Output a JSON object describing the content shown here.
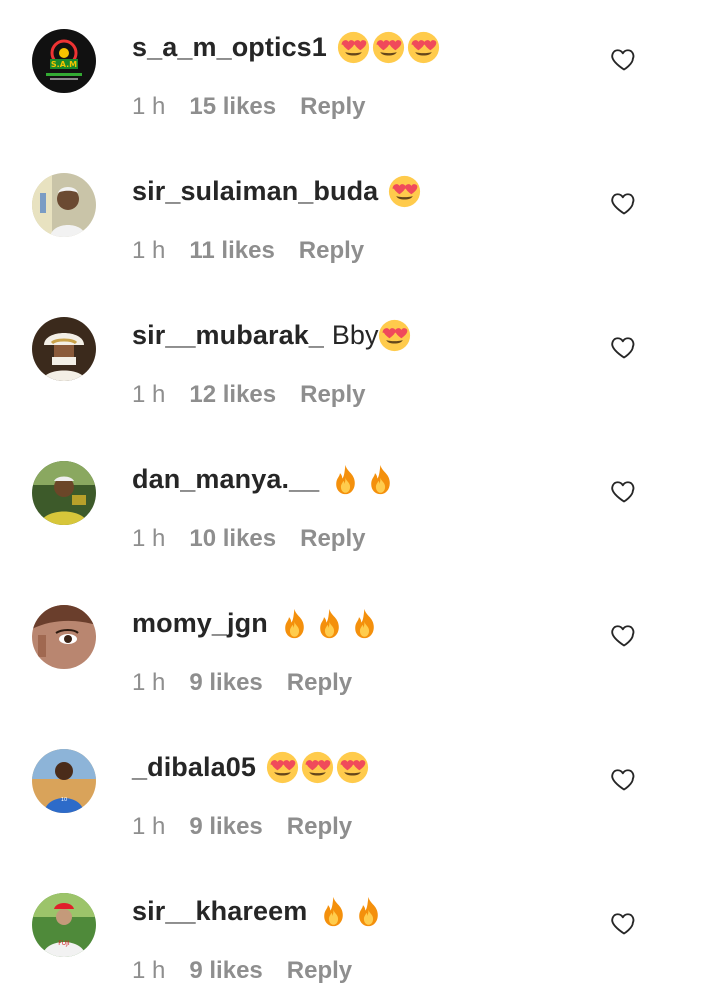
{
  "comments": [
    {
      "username": "s_a_m_optics1",
      "text": "",
      "emojis": [
        "heart-eyes",
        "heart-eyes",
        "heart-eyes"
      ],
      "time": "1 h",
      "likes": "15 likes",
      "reply": "Reply",
      "avatar_logo_text": "S.A.M"
    },
    {
      "username": "sir_sulaiman_buda",
      "text": "",
      "emojis": [
        "heart-eyes"
      ],
      "time": "1 h",
      "likes": "11 likes",
      "reply": "Reply"
    },
    {
      "username": "sir__mubarak_",
      "text": "Bby",
      "emojis": [
        "heart-eyes"
      ],
      "time": "1 h",
      "likes": "12 likes",
      "reply": "Reply"
    },
    {
      "username": "dan_manya.__",
      "text": "",
      "emojis": [
        "fire",
        "fire"
      ],
      "time": "1 h",
      "likes": "10 likes",
      "reply": "Reply"
    },
    {
      "username": "momy_jgn",
      "text": "",
      "emojis": [
        "fire",
        "fire",
        "fire"
      ],
      "time": "1 h",
      "likes": "9 likes",
      "reply": "Reply"
    },
    {
      "username": "_dibala05",
      "text": "",
      "emojis": [
        "heart-eyes",
        "heart-eyes",
        "heart-eyes"
      ],
      "time": "1 h",
      "likes": "9 likes",
      "reply": "Reply"
    },
    {
      "username": "sir__khareem",
      "text": "",
      "emojis": [
        "fire",
        "fire"
      ],
      "time": "1 h",
      "likes": "9 likes",
      "reply": "Reply"
    }
  ],
  "icons": {
    "like": "heart-outline-icon",
    "heart_eyes": "heart-eyes-emoji",
    "fire": "fire-emoji"
  },
  "colors": {
    "username": "#262626",
    "meta": "#8e8e8e",
    "background": "#ffffff"
  }
}
